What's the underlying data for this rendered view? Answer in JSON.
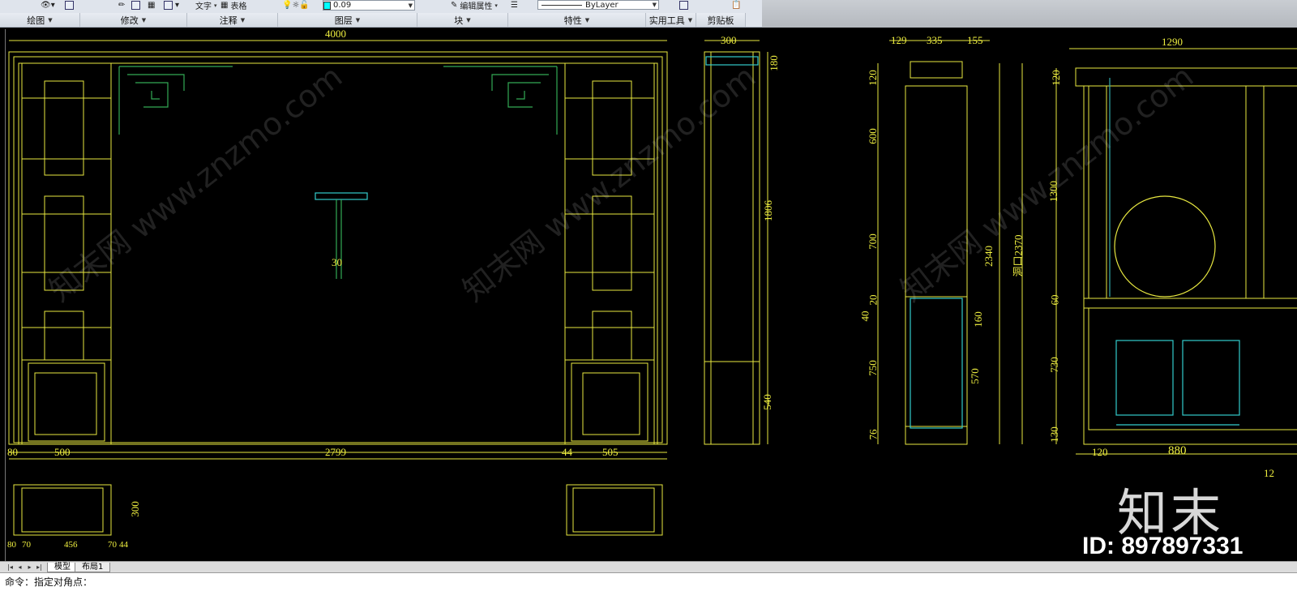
{
  "ribbon": {
    "panels": [
      {
        "label": "绘图"
      },
      {
        "label": "修改"
      },
      {
        "label": "注释"
      },
      {
        "label": "图层"
      },
      {
        "label": "块"
      },
      {
        "label": "特性"
      },
      {
        "label": "实用工具"
      },
      {
        "label": "剪贴板"
      }
    ],
    "text_tool_label": "文字",
    "table_tool_label": "表格",
    "layer_value": "0.09",
    "edit_attr_label": "编辑属性",
    "linetype_value": "ByLayer",
    "colors": {
      "layer_swatch": "#00ffff"
    }
  },
  "drawing": {
    "dims_top": [
      "4000",
      "300",
      "129",
      "335",
      "155",
      "1290"
    ],
    "dims_bottom": [
      "80",
      "500",
      "2799",
      "44",
      "505"
    ],
    "dims_right_880": [
      "120",
      "880"
    ],
    "side_dims": [
      "1806",
      "540"
    ],
    "section_dims": [
      "120",
      "600",
      "700",
      "20",
      "40",
      "750",
      "76"
    ],
    "section_dims_inner": [
      "160",
      "570",
      "2340",
      "洞口2370"
    ],
    "cabinet_dims": [
      "120",
      "1300",
      "60",
      "730",
      "130"
    ],
    "plan_dims": [
      "300",
      "80",
      "70",
      "456",
      "70",
      "44"
    ],
    "detail_label": "30",
    "top_small": "180",
    "edge_label": "12",
    "colors": {
      "yellow": "#ffff33",
      "cyan": "#33cccc",
      "green": "#33aa55",
      "white": "#e8e8e8"
    }
  },
  "watermark": {
    "site": "知末网 www.znzmo.com",
    "logo": "知末",
    "id_text": "ID: 897897331"
  },
  "tabs": {
    "model": "模型",
    "layout1": "布局1"
  },
  "command_line": "命令：指定对角点："
}
